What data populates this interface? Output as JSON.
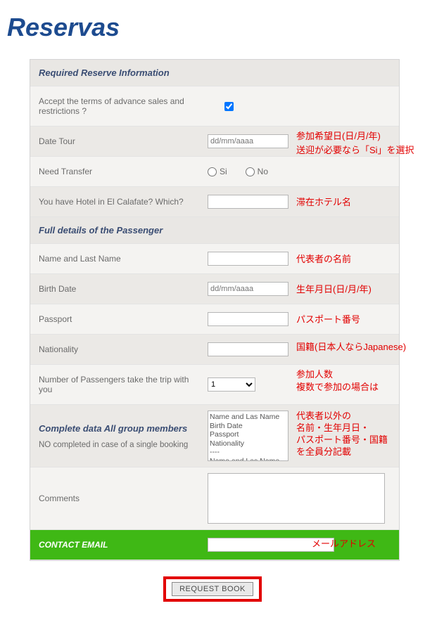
{
  "title": "Reservas",
  "section1": "Required Reserve Information",
  "accept": {
    "label": "Accept the terms of advance sales and restrictions ?"
  },
  "dateTour": {
    "label": "Date Tour",
    "placeholder": "dd/mm/aaaa",
    "annot": "参加希望日(日/月/年)"
  },
  "needTransfer": {
    "label": "Need Transfer",
    "si": "Si",
    "no": "No",
    "annot": "送迎が必要なら「Si」を選択"
  },
  "hotel": {
    "label": "You have Hotel in El Calafate? Which?",
    "annot": "滞在ホテル名"
  },
  "section2": "Full details of the Passenger",
  "name": {
    "label": "Name and Last Name",
    "annot": "代表者の名前"
  },
  "birth": {
    "label": "Birth Date",
    "placeholder": "dd/mm/aaaa",
    "annot": "生年月日(日/月/年)"
  },
  "passport": {
    "label": "Passport",
    "annot": "パスポート番号"
  },
  "nationality": {
    "label": "Nationality",
    "annot": "国籍(日本人ならJapanese)"
  },
  "numPax": {
    "label": "Number of Passengers take the trip with you",
    "value": "1",
    "annot1": "参加人数",
    "annot2": "複数で参加の場合は"
  },
  "group": {
    "main": "Complete data All group members",
    "sub": "NO completed in case of a single booking",
    "template": "Name and Las Name\nBirth Date\nPassport\nNationality\n----\nName and Las Name",
    "annot": "代表者以外の\n名前・生年月日・\nパスポート番号・国籍\nを全員分記載"
  },
  "comments": {
    "label": "Comments"
  },
  "email": {
    "label": "CONTACT EMAIL",
    "annot": "メールアドレス"
  },
  "submit": "REQUEST BOOK"
}
